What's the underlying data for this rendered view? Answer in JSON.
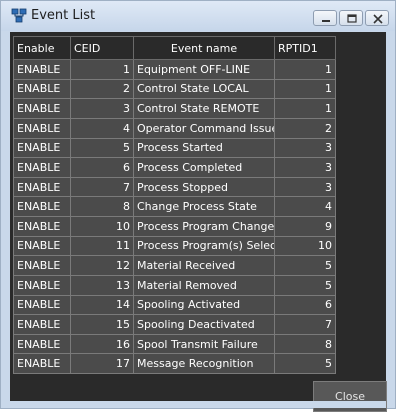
{
  "window": {
    "title": "Event List",
    "icon": "network-icon"
  },
  "table": {
    "headers": [
      "Enable",
      "CEID",
      "Event name",
      "RPTID1"
    ],
    "rows": [
      {
        "enable": "ENABLE",
        "ceid": "1",
        "event_name": "Equipment OFF-LINE",
        "rptid1": "1"
      },
      {
        "enable": "ENABLE",
        "ceid": "2",
        "event_name": "Control State LOCAL",
        "rptid1": "1"
      },
      {
        "enable": "ENABLE",
        "ceid": "3",
        "event_name": "Control State REMOTE",
        "rptid1": "1"
      },
      {
        "enable": "ENABLE",
        "ceid": "4",
        "event_name": "Operator Command Issued",
        "rptid1": "2"
      },
      {
        "enable": "ENABLE",
        "ceid": "5",
        "event_name": "Process Started",
        "rptid1": "3"
      },
      {
        "enable": "ENABLE",
        "ceid": "6",
        "event_name": "Process Completed",
        "rptid1": "3"
      },
      {
        "enable": "ENABLE",
        "ceid": "7",
        "event_name": "Process Stopped",
        "rptid1": "3"
      },
      {
        "enable": "ENABLE",
        "ceid": "8",
        "event_name": "Change Process State",
        "rptid1": "4"
      },
      {
        "enable": "ENABLE",
        "ceid": "10",
        "event_name": "Process Program Change",
        "rptid1": "9"
      },
      {
        "enable": "ENABLE",
        "ceid": "11",
        "event_name": "Process Program(s) Selected",
        "rptid1": "10"
      },
      {
        "enable": "ENABLE",
        "ceid": "12",
        "event_name": "Material Received",
        "rptid1": "5"
      },
      {
        "enable": "ENABLE",
        "ceid": "13",
        "event_name": "Material Removed",
        "rptid1": "5"
      },
      {
        "enable": "ENABLE",
        "ceid": "14",
        "event_name": "Spooling Activated",
        "rptid1": "6"
      },
      {
        "enable": "ENABLE",
        "ceid": "15",
        "event_name": "Spooling Deactivated",
        "rptid1": "7"
      },
      {
        "enable": "ENABLE",
        "ceid": "16",
        "event_name": "Spool Transmit Failure",
        "rptid1": "8"
      },
      {
        "enable": "ENABLE",
        "ceid": "17",
        "event_name": "Message Recognition",
        "rptid1": "5"
      }
    ]
  },
  "buttons": {
    "close_label": "Close"
  },
  "colors": {
    "client_background": "#2a2a2a",
    "cell_background": "#4b4b4b",
    "grid_line": "#7a7a7a",
    "text": "#ffffff",
    "frame": "#c9d8ea"
  }
}
